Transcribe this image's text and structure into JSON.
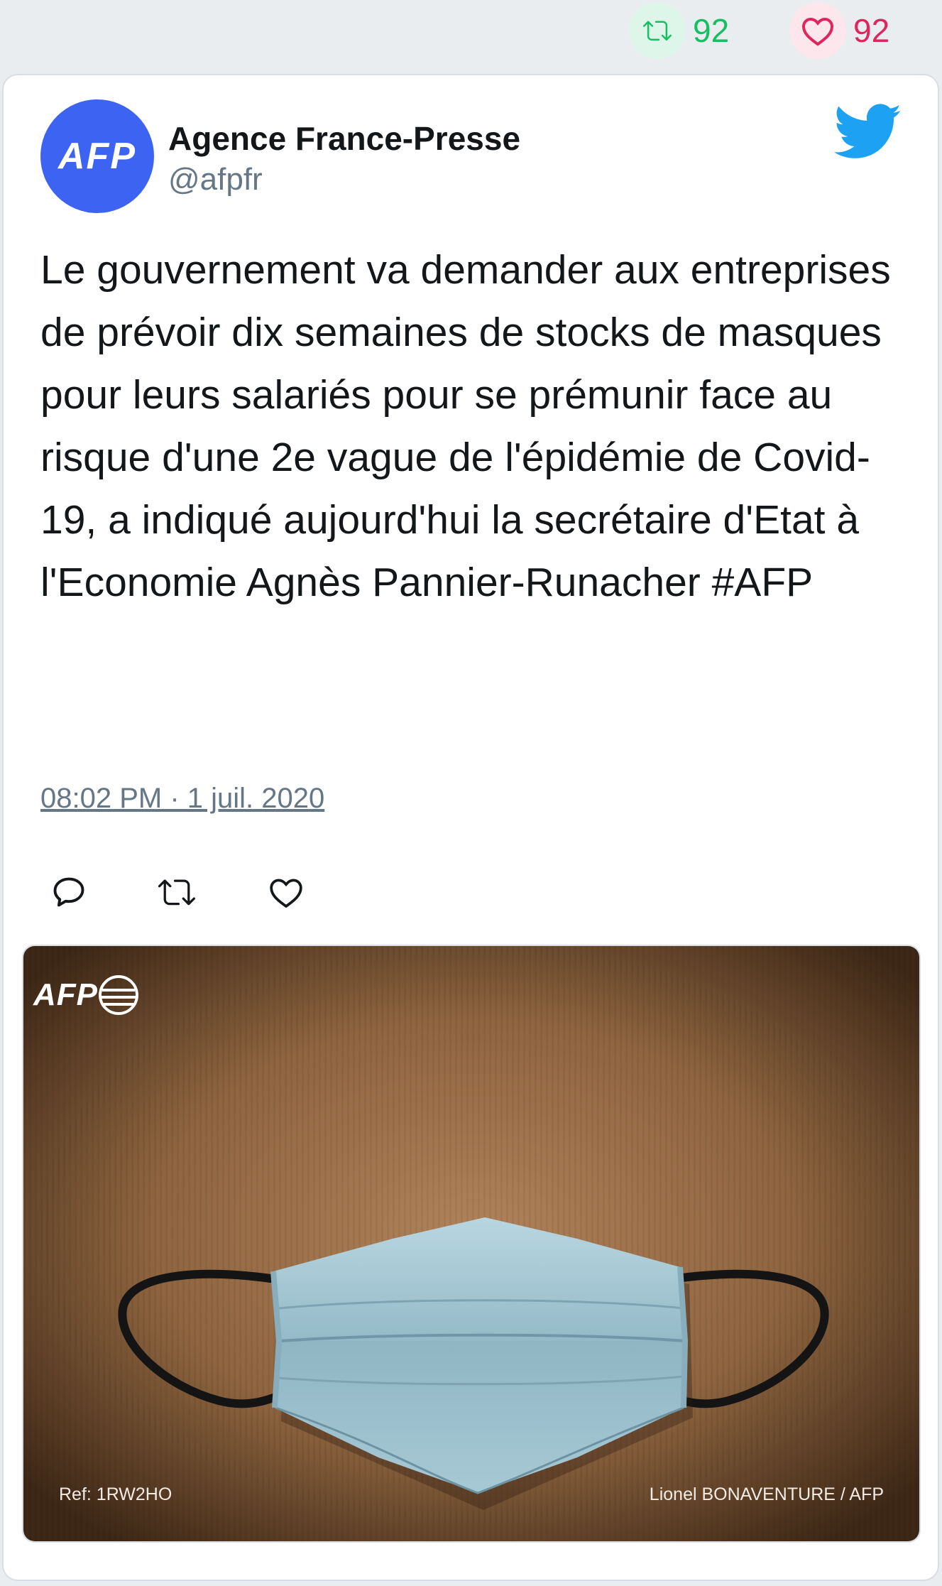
{
  "stats": {
    "retweets": "92",
    "likes": "92"
  },
  "tweet": {
    "avatar_text": "AFP",
    "display_name": "Agence France-Presse",
    "handle": "@afpfr",
    "text": "Le gouvernement va demander aux entreprises de prévoir dix semaines de stocks de masques pour leurs salariés pour se prémunir face au risque d'une 2e vague de l'épidémie de Covid-19, a indiqué aujourd'hui la secrétaire d'Etat à l'Economie Agnès Pannier-Runacher #AFP",
    "timestamp": "08:02 PM · 1 juil. 2020"
  },
  "media": {
    "logo_text": "AFP",
    "ref": "Ref: 1RW2HO",
    "credit": "Lionel BONAVENTURE / AFP"
  },
  "icons": {
    "retweet": "retweet-icon",
    "like": "heart-icon",
    "reply": "reply-icon",
    "twitter": "twitter-bird-icon"
  },
  "colors": {
    "retweet_green": "#17bf63",
    "like_red": "#e0245e",
    "twitter_blue": "#1da1f2",
    "avatar_blue": "#3c63f2",
    "muted_gray": "#657786",
    "text_dark": "#14171a"
  }
}
